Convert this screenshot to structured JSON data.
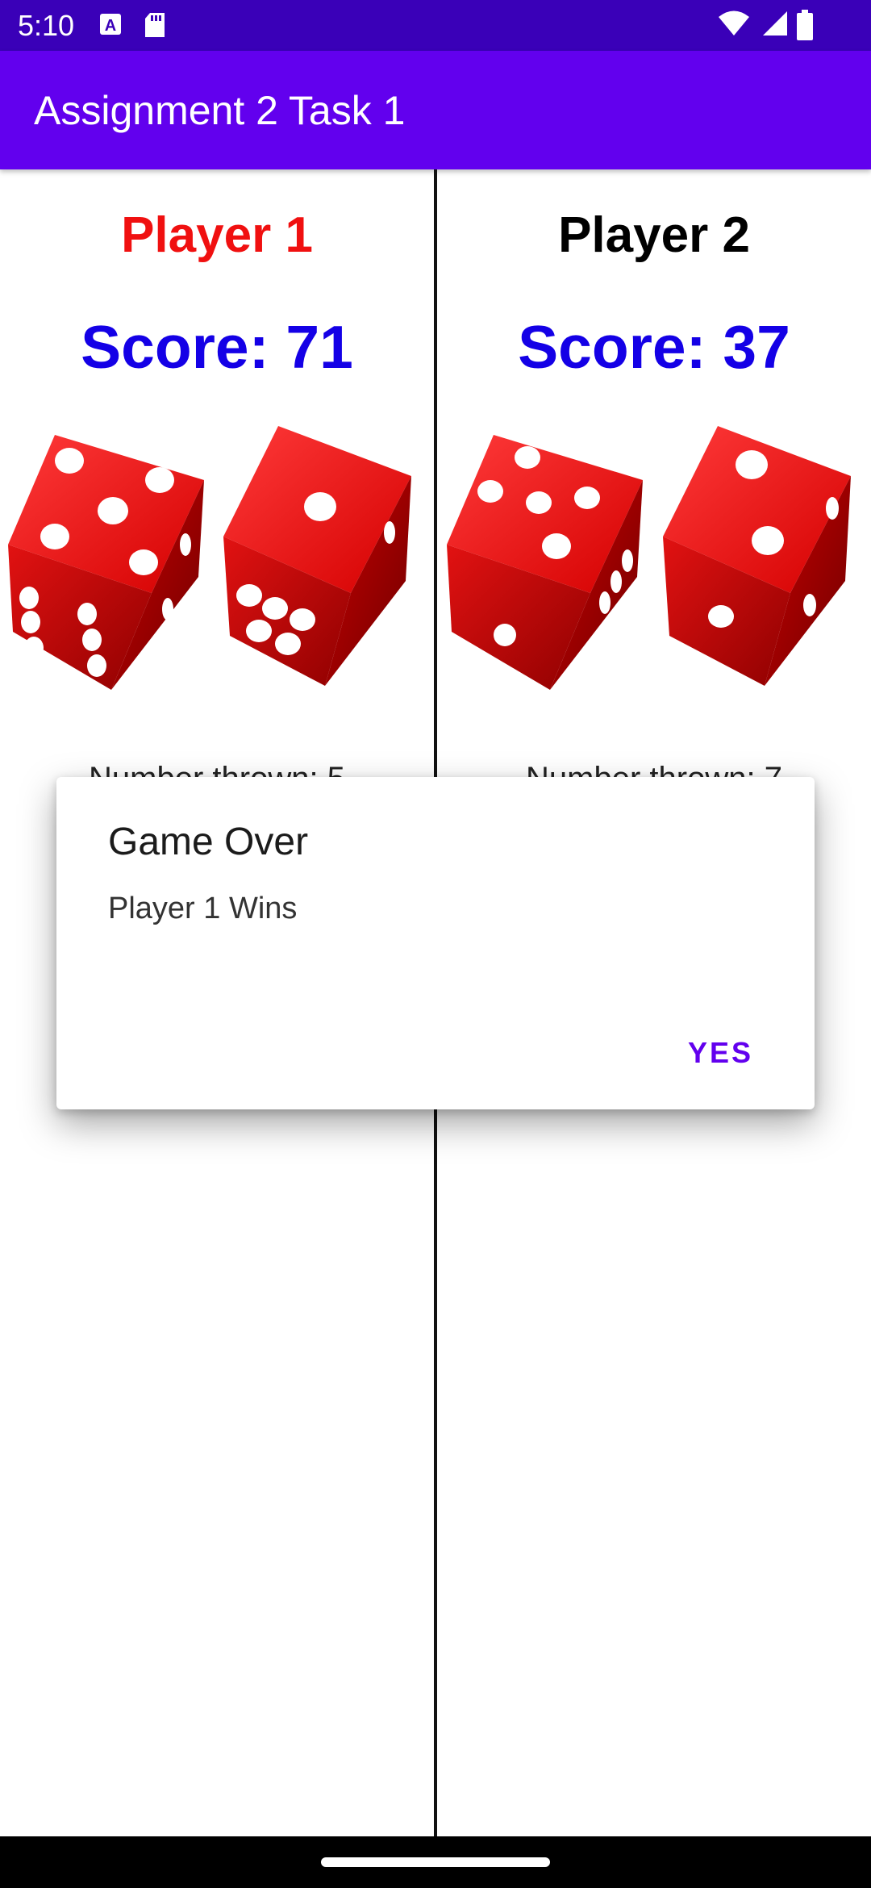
{
  "status_bar": {
    "time": "5:10",
    "left_icons": [
      "font-icon",
      "sd-card-icon"
    ],
    "right_icons": [
      "wifi-icon",
      "signal-icon",
      "battery-icon"
    ]
  },
  "app_bar": {
    "title": "Assignment 2 Task 1"
  },
  "players": [
    {
      "name": "Player 1",
      "name_color": "#f01010",
      "score": "Score: 71",
      "number_text": "Number thrown: 5",
      "dice": [
        5,
        2
      ]
    },
    {
      "name": "Player 2",
      "name_color": "#000000",
      "score": "Score: 37",
      "number_text": "Number thrown: 7",
      "dice": [
        5,
        2
      ]
    }
  ],
  "dialog": {
    "title": "Game Over",
    "message": "Player 1 Wins",
    "button": "YES"
  },
  "colors": {
    "primary": "#6200ee",
    "status_bar": "#3a00b8",
    "score": "#1400e6",
    "dice": "#d80a0a"
  }
}
